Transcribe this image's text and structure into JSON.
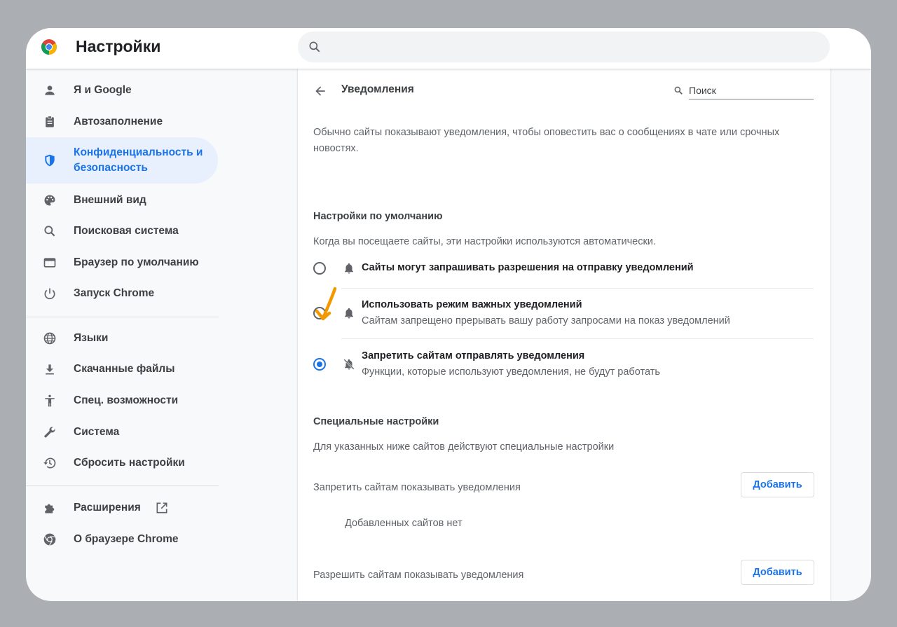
{
  "app": {
    "title": "Настройки"
  },
  "search": {
    "placeholder": ""
  },
  "sidebar": {
    "items": [
      {
        "label": "Я и Google",
        "icon": "person-icon"
      },
      {
        "label": "Автозаполнение",
        "icon": "clipboard-icon"
      },
      {
        "label": "Конфиденциальность и безопасность",
        "icon": "shield-icon",
        "active": true
      },
      {
        "label": "Внешний вид",
        "icon": "palette-icon"
      },
      {
        "label": "Поисковая система",
        "icon": "search-icon"
      },
      {
        "label": "Браузер по умолчанию",
        "icon": "browser-window-icon"
      },
      {
        "label": "Запуск Chrome",
        "icon": "power-icon"
      },
      {
        "label": "Языки",
        "icon": "globe-icon"
      },
      {
        "label": "Скачанные файлы",
        "icon": "download-icon"
      },
      {
        "label": "Спец. возможности",
        "icon": "accessibility-icon"
      },
      {
        "label": "Система",
        "icon": "wrench-icon"
      },
      {
        "label": "Сбросить настройки",
        "icon": "history-icon"
      },
      {
        "label": "Расширения",
        "icon": "puzzle-icon"
      },
      {
        "label": "О браузере Chrome",
        "icon": "chrome-logo-icon"
      }
    ]
  },
  "page": {
    "title": "Уведомления",
    "search_placeholder": "Поиск",
    "intro": "Обычно сайты показывают уведомления, чтобы оповестить вас о сообщениях в чате или срочных новостях.",
    "default_heading": "Настройки по умолчанию",
    "default_desc": "Когда вы посещаете сайты, эти настройки используются автоматически.",
    "options": [
      {
        "label": "Сайты могут запрашивать разрешения на отправку уведомлений",
        "sub": "",
        "checked": false,
        "icon": "bell-icon"
      },
      {
        "label": "Использовать режим важных уведомлений",
        "sub": "Сайтам запрещено прерывать вашу работу запросами на показ уведомлений",
        "checked": false,
        "icon": "bell-icon"
      },
      {
        "label": "Запретить сайтам отправлять уведомления",
        "sub": "Функции, которые используют уведомления, не будут работать",
        "checked": true,
        "icon": "bell-off-icon"
      }
    ],
    "custom_heading": "Специальные настройки",
    "custom_desc": "Для указанных ниже сайтов действуют специальные настройки",
    "block_label": "Запретить сайтам показывать уведомления",
    "allow_label": "Разрешить сайтам показывать уведомления",
    "add_label": "Добавить",
    "empty_label": "Добавленных сайтов нет"
  },
  "colors": {
    "accent": "#1a73e8",
    "annotation_arrow": "#f29900"
  }
}
